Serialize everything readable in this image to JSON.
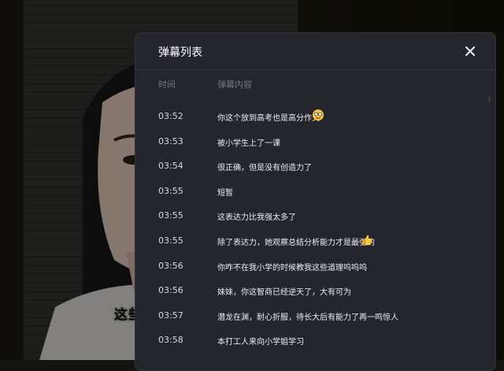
{
  "panel": {
    "title": "弹幕列表",
    "columns": {
      "time": "时间",
      "content": "弹幕内容"
    },
    "close_icon": "close-icon"
  },
  "video": {
    "subtitle": "这些规"
  },
  "danmaku": [
    {
      "time": "03:52",
      "text": "你这个放到高考也是高分作文",
      "emoji": "smiling-face-icon"
    },
    {
      "time": "03:53",
      "text": "被小学生上了一课"
    },
    {
      "time": "03:54",
      "text": "很正确，但是没有创造力了"
    },
    {
      "time": "03:55",
      "text": "短暂"
    },
    {
      "time": "03:55",
      "text": "这表达力比我强太多了"
    },
    {
      "time": "03:55",
      "text": "除了表达力，她观察总结分析能力才是最强的",
      "emoji": "thumbs-up-icon"
    },
    {
      "time": "03:56",
      "text": "你咋不在我小学的时候教我这些道理呜呜呜"
    },
    {
      "time": "03:56",
      "text": "妹妹，你这智商已经逆天了，大有可为"
    },
    {
      "time": "03:57",
      "text": "潜龙在渊，耐心折服，待长大后有能力了再一鸣惊人"
    },
    {
      "time": "03:58",
      "text": "本打工人来向小学姐学习"
    }
  ],
  "colors": {
    "panel_bg": "#25252e",
    "text_primary": "#ececf0",
    "text_muted": "#777784"
  }
}
